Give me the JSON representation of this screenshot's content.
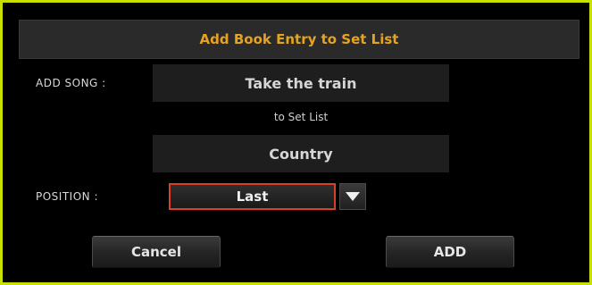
{
  "dialog": {
    "title": "Add Book Entry to Set List",
    "add_song_label": "ADD SONG :",
    "song_name": "Take the train",
    "to_set_list_text": "to Set List",
    "set_list_name": "Country",
    "position_label": "POSITION :",
    "position_value": "Last",
    "position_dropdown_icon": "triangle-down-icon",
    "cancel_label": "Cancel",
    "add_label": "ADD"
  },
  "colors": {
    "frame_border": "#c8e000",
    "title_text": "#e5a321",
    "selected_border": "#d9402a"
  }
}
